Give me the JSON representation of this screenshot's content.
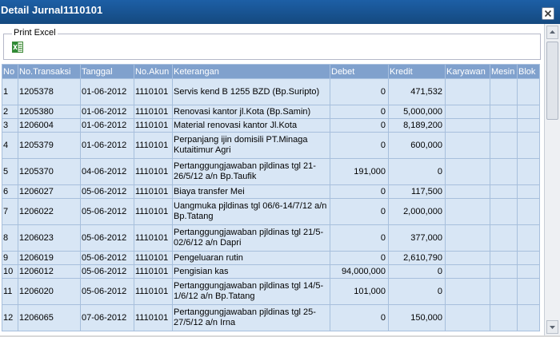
{
  "window": {
    "title": "Detail Jurnal1110101"
  },
  "toolbar": {
    "legend": "Print Excel",
    "excel_icon": "excel-icon"
  },
  "table": {
    "columns": [
      "No",
      "No.Transaksi",
      "Tanggal",
      "No.Akun",
      "Keterangan",
      "Debet",
      "Kredit",
      "Karyawan",
      "Mesin",
      "Blok"
    ],
    "rows": [
      [
        "1",
        "1205378",
        "01-06-2012",
        "1110101",
        "Servis kend B 1255 BZD (Bp.Suripto)",
        "0",
        "471,532",
        "",
        "",
        ""
      ],
      [
        "2",
        "1205380",
        "01-06-2012",
        "1110101",
        "Renovasi kantor jl.Kota (Bp.Samin)",
        "0",
        "5,000,000",
        "",
        "",
        ""
      ],
      [
        "3",
        "1206004",
        "01-06-2012",
        "1110101",
        "Material renovasi kantor Jl.Kota",
        "0",
        "8,189,200",
        "",
        "",
        ""
      ],
      [
        "4",
        "1205379",
        "01-06-2012",
        "1110101",
        "Perpanjang ijin domisili PT.Minaga Kutaitimur Agri",
        "0",
        "600,000",
        "",
        "",
        ""
      ],
      [
        "5",
        "1205370",
        "04-06-2012",
        "1110101",
        "Pertanggungjawaban pjldinas tgl 21-26/5/12 a/n Bp.Taufik",
        "191,000",
        "0",
        "",
        "",
        ""
      ],
      [
        "6",
        "1206027",
        "05-06-2012",
        "1110101",
        "Biaya transfer Mei",
        "0",
        "117,500",
        "",
        "",
        ""
      ],
      [
        "7",
        "1206022",
        "05-06-2012",
        "1110101",
        "Uangmuka pjldinas tgl 06/6-14/7/12 a/n Bp.Tatang",
        "0",
        "2,000,000",
        "",
        "",
        ""
      ],
      [
        "8",
        "1206023",
        "05-06-2012",
        "1110101",
        "Pertanggungjawaban pjldinas tgl 21/5-02/6/12 a/n Dapri",
        "0",
        "377,000",
        "",
        "",
        ""
      ],
      [
        "9",
        "1206019",
        "05-06-2012",
        "1110101",
        "Pengeluaran rutin",
        "0",
        "2,610,790",
        "",
        "",
        ""
      ],
      [
        "10",
        "1206012",
        "05-06-2012",
        "1110101",
        "Pengisian kas",
        "94,000,000",
        "0",
        "",
        "",
        ""
      ],
      [
        "11",
        "1206020",
        "05-06-2012",
        "1110101",
        "Pertanggungjawaban pjldinas tgl 14/5-1/6/12 a/n Bp.Tatang",
        "101,000",
        "0",
        "",
        "",
        ""
      ],
      [
        "12",
        "1206065",
        "07-06-2012",
        "1110101",
        "Pertanggungjawaban pjldinas tgl 25-27/5/12 a/n Irna",
        "0",
        "150,000",
        "",
        "",
        ""
      ]
    ]
  }
}
